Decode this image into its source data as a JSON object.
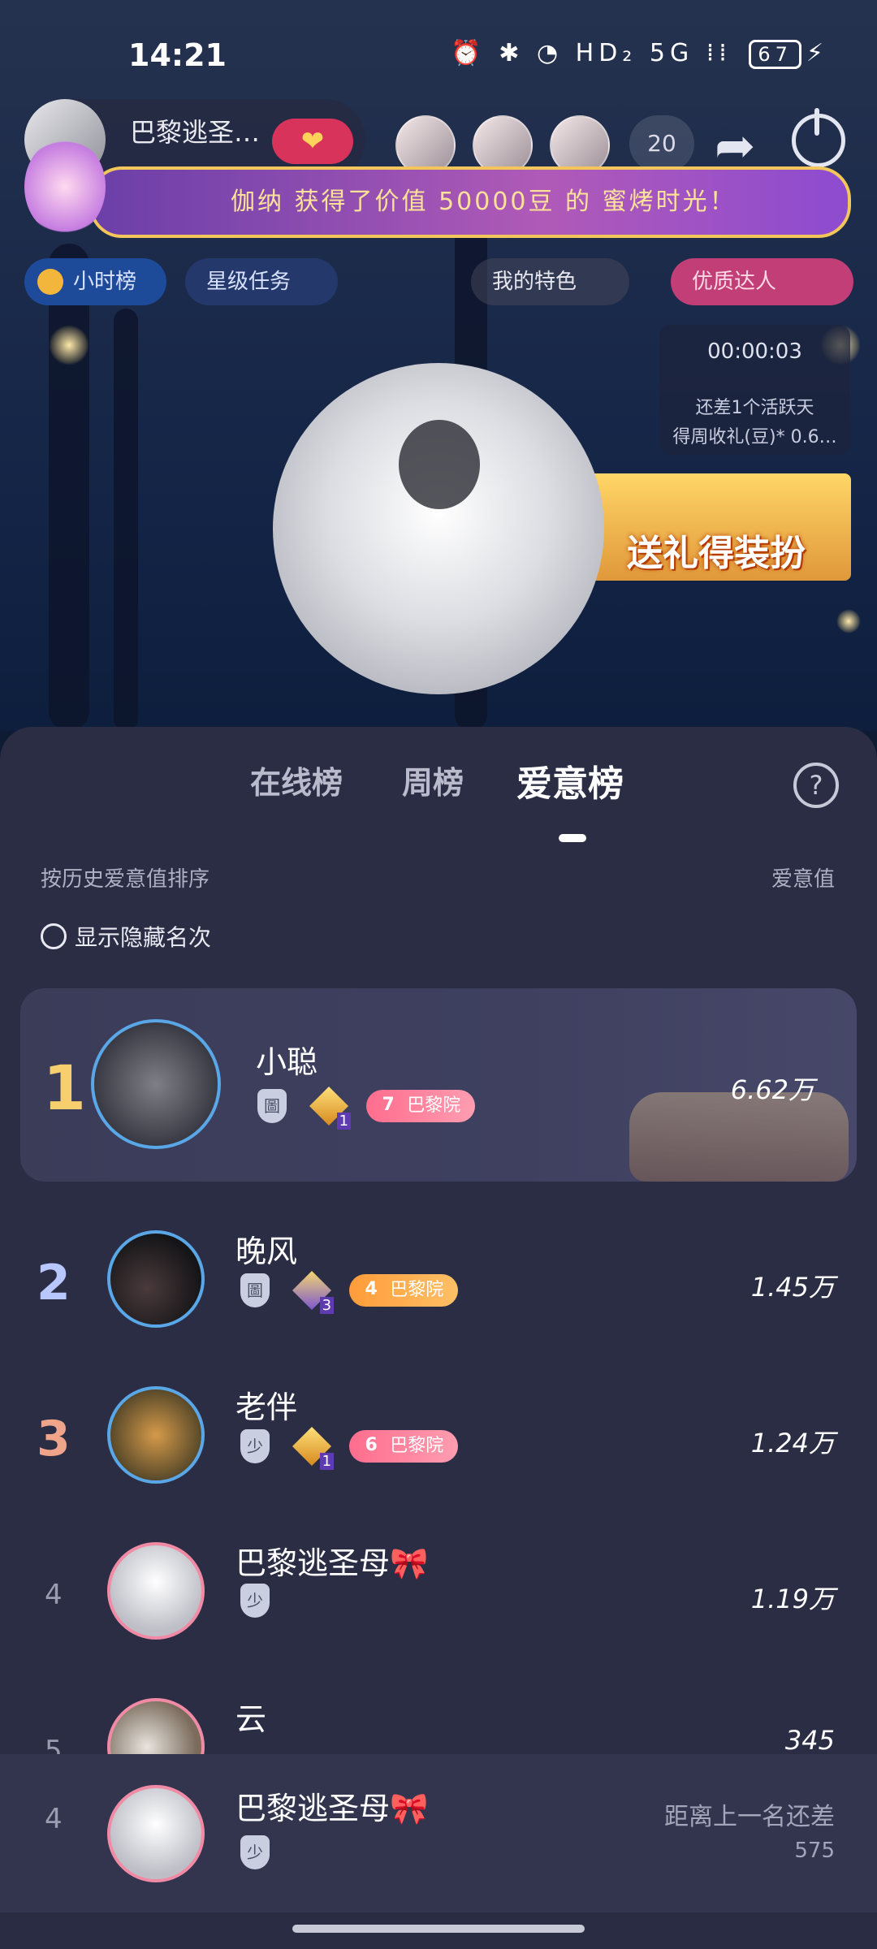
{
  "status_bar": {
    "time": "14:21",
    "icons": "⏰ ✱ ◔ HD₂ 5G ⁞⁞",
    "battery": "67"
  },
  "room": {
    "host_name": "巴黎逃圣…",
    "heart_label": "❤",
    "viewer_count": "20",
    "announcement": "伽纳 获得了价值 50000豆 的 蜜烤时光！",
    "tags": {
      "hour_rank": "小时榜",
      "star_task": "星级任务",
      "feature": "我的特色",
      "expert": "优质达人"
    },
    "timer": "00:00:03",
    "activity_line1": "还差1个活跃天",
    "activity_line2": "得周收礼(豆)* 0.6…",
    "gift_banner": "送礼得装扮"
  },
  "sheet": {
    "tabs": [
      "在线榜",
      "周榜",
      "爱意榜"
    ],
    "active_tab": "爱意榜",
    "sort_label": "按历史爱意值排序",
    "value_header": "爱意值",
    "toggle_label": "显示隐藏名次",
    "ranking": [
      {
        "rank": "1",
        "name": "小聪",
        "value": "6.62万",
        "gem_level": "1",
        "fan_level": "7",
        "fan_name": "巴黎院"
      },
      {
        "rank": "2",
        "name": "晚风",
        "value": "1.45万",
        "gem_level": "3",
        "fan_level": "4",
        "fan_name": "巴黎院"
      },
      {
        "rank": "3",
        "name": "老伴",
        "value": "1.24万",
        "gem_level": "1",
        "fan_level": "6",
        "fan_name": "巴黎院"
      },
      {
        "rank": "4",
        "name": "巴黎逃圣母🎀",
        "value": "1.19万"
      },
      {
        "rank": "5",
        "name": "云",
        "value": "345"
      }
    ],
    "self": {
      "rank": "4",
      "name": "巴黎逃圣母🎀",
      "hint": "距离上一名还差",
      "gap": "575"
    },
    "shield_glyph_1": "圖",
    "shield_glyph_2": "少"
  },
  "colors": {
    "sheet_bg": "#2b2d45",
    "rank1_gold": "#f7cf6e",
    "rank2_blue": "#b9c7ff",
    "rank3_peach": "#f0a58a",
    "fan_badge_pink": "#ff6d8e"
  }
}
